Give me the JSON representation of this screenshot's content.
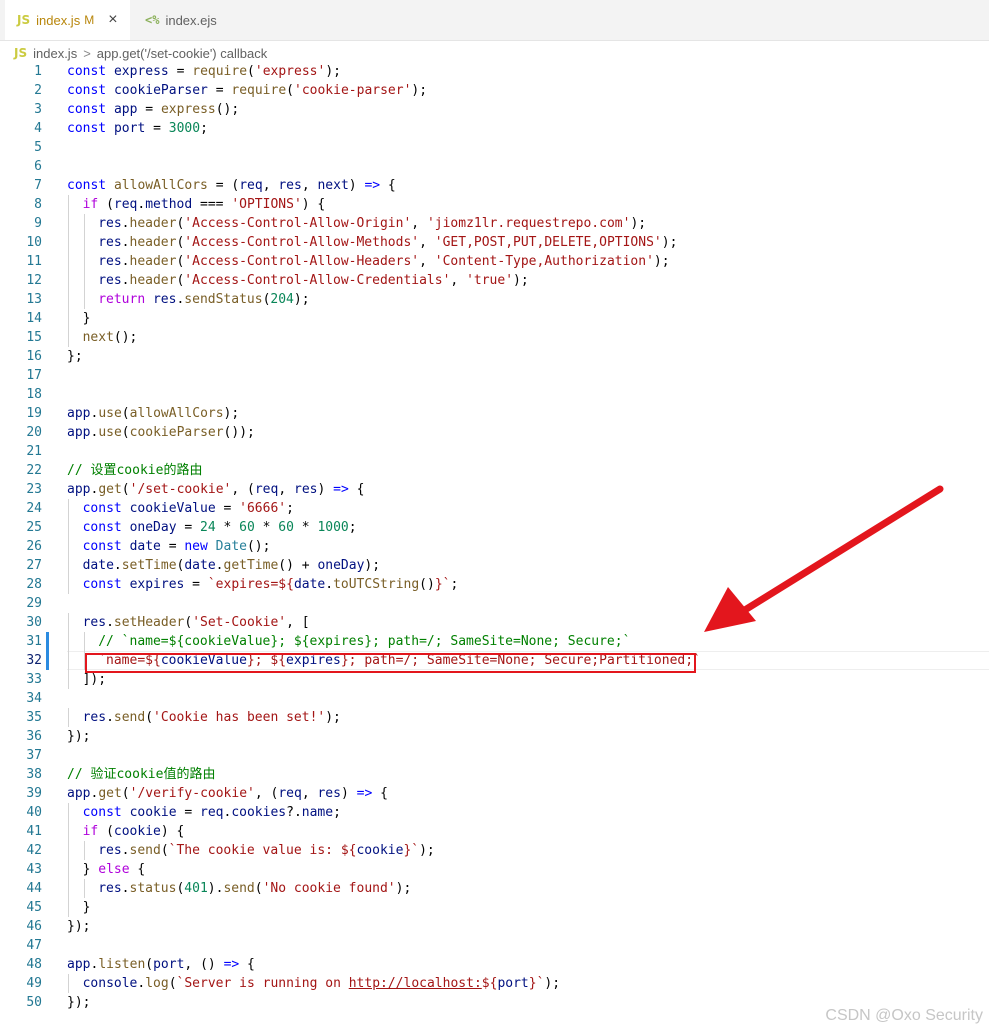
{
  "tabs": [
    {
      "badge": "JS",
      "name": "index.js",
      "modified": "M",
      "close": "×"
    },
    {
      "badge": "<%",
      "name": "index.ejs"
    }
  ],
  "breadcrumb": {
    "badge": "JS",
    "file": "index.js",
    "sep": ">",
    "symbol": "app.get('/set-cookie') callback"
  },
  "lines": [
    {
      "num": "1",
      "indent": 0,
      "tokens": [
        [
          "k",
          "const"
        ],
        [
          "",
          "",
          " "
        ],
        [
          "v",
          "express"
        ],
        [
          "",
          " = "
        ],
        [
          "f",
          "require"
        ],
        [
          "",
          "("
        ],
        [
          "s",
          "'express'"
        ],
        [
          "",
          ");"
        ]
      ]
    },
    {
      "num": "2",
      "indent": 0,
      "tokens": [
        [
          "k",
          "const"
        ],
        [
          "",
          " "
        ],
        [
          "v",
          "cookieParser"
        ],
        [
          "",
          " = "
        ],
        [
          "f",
          "require"
        ],
        [
          "",
          "("
        ],
        [
          "s",
          "'cookie-parser'"
        ],
        [
          "",
          ");"
        ]
      ]
    },
    {
      "num": "3",
      "indent": 0,
      "tokens": [
        [
          "k",
          "const"
        ],
        [
          "",
          " "
        ],
        [
          "v",
          "app"
        ],
        [
          "",
          " = "
        ],
        [
          "f",
          "express"
        ],
        [
          "",
          "();"
        ]
      ]
    },
    {
      "num": "4",
      "indent": 0,
      "tokens": [
        [
          "k",
          "const"
        ],
        [
          "",
          " "
        ],
        [
          "v",
          "port"
        ],
        [
          "",
          " = "
        ],
        [
          "n",
          "3000"
        ],
        [
          "",
          ";"
        ]
      ]
    },
    {
      "num": "5",
      "indent": 0,
      "tokens": []
    },
    {
      "num": "6",
      "indent": 0,
      "tokens": []
    },
    {
      "num": "7",
      "indent": 0,
      "tokens": [
        [
          "k",
          "const"
        ],
        [
          "",
          " "
        ],
        [
          "f",
          "allowAllCors"
        ],
        [
          "",
          " = ("
        ],
        [
          "v",
          "req"
        ],
        [
          "",
          ", "
        ],
        [
          "v",
          "res"
        ],
        [
          "",
          ", "
        ],
        [
          "v",
          "next"
        ],
        [
          "",
          ") "
        ],
        [
          "k",
          "=>"
        ],
        [
          "",
          " {"
        ]
      ]
    },
    {
      "num": "8",
      "indent": 1,
      "tokens": [
        [
          "kc",
          "if"
        ],
        [
          "",
          " ("
        ],
        [
          "v",
          "req"
        ],
        [
          "",
          "."
        ],
        [
          "v",
          "method"
        ],
        [
          "",
          " === "
        ],
        [
          "s",
          "'OPTIONS'"
        ],
        [
          "",
          ") {"
        ]
      ]
    },
    {
      "num": "9",
      "indent": 2,
      "tokens": [
        [
          "v",
          "res"
        ],
        [
          "",
          "."
        ],
        [
          "f",
          "header"
        ],
        [
          "",
          "("
        ],
        [
          "s",
          "'Access-Control-Allow-Origin'"
        ],
        [
          "",
          ", "
        ],
        [
          "s",
          "'jiomz1lr.requestrepo.com'"
        ],
        [
          "",
          ");"
        ]
      ]
    },
    {
      "num": "10",
      "indent": 2,
      "tokens": [
        [
          "v",
          "res"
        ],
        [
          "",
          "."
        ],
        [
          "f",
          "header"
        ],
        [
          "",
          "("
        ],
        [
          "s",
          "'Access-Control-Allow-Methods'"
        ],
        [
          "",
          ", "
        ],
        [
          "s",
          "'GET,POST,PUT,DELETE,OPTIONS'"
        ],
        [
          "",
          ");"
        ]
      ]
    },
    {
      "num": "11",
      "indent": 2,
      "tokens": [
        [
          "v",
          "res"
        ],
        [
          "",
          "."
        ],
        [
          "f",
          "header"
        ],
        [
          "",
          "("
        ],
        [
          "s",
          "'Access-Control-Allow-Headers'"
        ],
        [
          "",
          ", "
        ],
        [
          "s",
          "'Content-Type,Authorization'"
        ],
        [
          "",
          ");"
        ]
      ]
    },
    {
      "num": "12",
      "indent": 2,
      "tokens": [
        [
          "v",
          "res"
        ],
        [
          "",
          "."
        ],
        [
          "f",
          "header"
        ],
        [
          "",
          "("
        ],
        [
          "s",
          "'Access-Control-Allow-Credentials'"
        ],
        [
          "",
          ", "
        ],
        [
          "s",
          "'true'"
        ],
        [
          "",
          ");"
        ]
      ]
    },
    {
      "num": "13",
      "indent": 2,
      "tokens": [
        [
          "kc",
          "return"
        ],
        [
          "",
          " "
        ],
        [
          "v",
          "res"
        ],
        [
          "",
          "."
        ],
        [
          "f",
          "sendStatus"
        ],
        [
          "",
          "("
        ],
        [
          "n",
          "204"
        ],
        [
          "",
          ");"
        ]
      ]
    },
    {
      "num": "14",
      "indent": 1,
      "tokens": [
        [
          "",
          "}"
        ]
      ]
    },
    {
      "num": "15",
      "indent": 1,
      "tokens": [
        [
          "f",
          "next"
        ],
        [
          "",
          "();"
        ]
      ]
    },
    {
      "num": "16",
      "indent": 0,
      "tokens": [
        [
          "",
          "};"
        ]
      ]
    },
    {
      "num": "17",
      "indent": 0,
      "tokens": []
    },
    {
      "num": "18",
      "indent": 0,
      "tokens": []
    },
    {
      "num": "19",
      "indent": 0,
      "tokens": [
        [
          "v",
          "app"
        ],
        [
          "",
          "."
        ],
        [
          "f",
          "use"
        ],
        [
          "",
          "("
        ],
        [
          "f",
          "allowAllCors"
        ],
        [
          "",
          ");"
        ]
      ]
    },
    {
      "num": "20",
      "indent": 0,
      "tokens": [
        [
          "v",
          "app"
        ],
        [
          "",
          "."
        ],
        [
          "f",
          "use"
        ],
        [
          "",
          "("
        ],
        [
          "f",
          "cookieParser"
        ],
        [
          "",
          "());"
        ]
      ]
    },
    {
      "num": "21",
      "indent": 0,
      "tokens": []
    },
    {
      "num": "22",
      "indent": 0,
      "tokens": [
        [
          "c",
          "// 设置cookie的路由"
        ]
      ]
    },
    {
      "num": "23",
      "indent": 0,
      "tokens": [
        [
          "v",
          "app"
        ],
        [
          "",
          "."
        ],
        [
          "f",
          "get"
        ],
        [
          "",
          "("
        ],
        [
          "s",
          "'/set-cookie'"
        ],
        [
          "",
          ", ("
        ],
        [
          "v",
          "req"
        ],
        [
          "",
          ", "
        ],
        [
          "v",
          "res"
        ],
        [
          "",
          ") "
        ],
        [
          "k",
          "=>"
        ],
        [
          "",
          " {"
        ]
      ]
    },
    {
      "num": "24",
      "indent": 1,
      "tokens": [
        [
          "k",
          "const"
        ],
        [
          "",
          " "
        ],
        [
          "v",
          "cookieValue"
        ],
        [
          "",
          " = "
        ],
        [
          "s",
          "'6666'"
        ],
        [
          "",
          ";"
        ]
      ]
    },
    {
      "num": "25",
      "indent": 1,
      "tokens": [
        [
          "k",
          "const"
        ],
        [
          "",
          " "
        ],
        [
          "v",
          "oneDay"
        ],
        [
          "",
          " = "
        ],
        [
          "n",
          "24"
        ],
        [
          "",
          " * "
        ],
        [
          "n",
          "60"
        ],
        [
          "",
          " * "
        ],
        [
          "n",
          "60"
        ],
        [
          "",
          " * "
        ],
        [
          "n",
          "1000"
        ],
        [
          "",
          ";"
        ]
      ]
    },
    {
      "num": "26",
      "indent": 1,
      "tokens": [
        [
          "k",
          "const"
        ],
        [
          "",
          " "
        ],
        [
          "v",
          "date"
        ],
        [
          "",
          " = "
        ],
        [
          "k",
          "new"
        ],
        [
          "",
          " "
        ],
        [
          "t",
          "Date"
        ],
        [
          "",
          "();"
        ]
      ]
    },
    {
      "num": "27",
      "indent": 1,
      "tokens": [
        [
          "v",
          "date"
        ],
        [
          "",
          "."
        ],
        [
          "f",
          "setTime"
        ],
        [
          "",
          "("
        ],
        [
          "v",
          "date"
        ],
        [
          "",
          "."
        ],
        [
          "f",
          "getTime"
        ],
        [
          "",
          "() + "
        ],
        [
          "v",
          "oneDay"
        ],
        [
          "",
          ");"
        ]
      ]
    },
    {
      "num": "28",
      "indent": 1,
      "tokens": [
        [
          "k",
          "const"
        ],
        [
          "",
          " "
        ],
        [
          "v",
          "expires"
        ],
        [
          "",
          " = "
        ],
        [
          "s",
          "`expires=${"
        ],
        [
          "v",
          "date"
        ],
        [
          "",
          "."
        ],
        [
          "f",
          "toUTCString"
        ],
        [
          "",
          "()"
        ],
        [
          "s",
          "}`"
        ],
        [
          "",
          ";"
        ]
      ]
    },
    {
      "num": "29",
      "indent": 0,
      "tokens": []
    },
    {
      "num": "30",
      "indent": 1,
      "tokens": [
        [
          "v",
          "res"
        ],
        [
          "",
          "."
        ],
        [
          "f",
          "setHeader"
        ],
        [
          "",
          "("
        ],
        [
          "s",
          "'Set-Cookie'"
        ],
        [
          "",
          ", ["
        ]
      ]
    },
    {
      "num": "31",
      "indent": 2,
      "tokens": [
        [
          "c",
          "// `name=${cookieValue}; ${expires}; path=/; SameSite=None; Secure;`"
        ]
      ]
    },
    {
      "num": "32",
      "indent": 2,
      "tokens": [
        [
          "s",
          "`name=${"
        ],
        [
          "v",
          "cookieValue"
        ],
        [
          "s",
          "}; ${"
        ],
        [
          "v",
          "expires"
        ],
        [
          "s",
          "}; path=/; SameSite=None; Secure;Partitioned;`"
        ]
      ]
    },
    {
      "num": "33",
      "indent": 1,
      "tokens": [
        [
          "",
          "]);"
        ]
      ]
    },
    {
      "num": "34",
      "indent": 0,
      "tokens": []
    },
    {
      "num": "35",
      "indent": 1,
      "tokens": [
        [
          "v",
          "res"
        ],
        [
          "",
          "."
        ],
        [
          "f",
          "send"
        ],
        [
          "",
          "("
        ],
        [
          "s",
          "'Cookie has been set!'"
        ],
        [
          "",
          ");"
        ]
      ]
    },
    {
      "num": "36",
      "indent": 0,
      "tokens": [
        [
          "",
          "});"
        ]
      ]
    },
    {
      "num": "37",
      "indent": 0,
      "tokens": []
    },
    {
      "num": "38",
      "indent": 0,
      "tokens": [
        [
          "c",
          "// 验证cookie值的路由"
        ]
      ]
    },
    {
      "num": "39",
      "indent": 0,
      "tokens": [
        [
          "v",
          "app"
        ],
        [
          "",
          "."
        ],
        [
          "f",
          "get"
        ],
        [
          "",
          "("
        ],
        [
          "s",
          "'/verify-cookie'"
        ],
        [
          "",
          ", ("
        ],
        [
          "v",
          "req"
        ],
        [
          "",
          ", "
        ],
        [
          "v",
          "res"
        ],
        [
          "",
          ") "
        ],
        [
          "k",
          "=>"
        ],
        [
          "",
          " {"
        ]
      ]
    },
    {
      "num": "40",
      "indent": 1,
      "tokens": [
        [
          "k",
          "const"
        ],
        [
          "",
          " "
        ],
        [
          "v",
          "cookie"
        ],
        [
          "",
          " = "
        ],
        [
          "v",
          "req"
        ],
        [
          "",
          "."
        ],
        [
          "v",
          "cookies"
        ],
        [
          "",
          "?."
        ],
        [
          "v",
          "name"
        ],
        [
          "",
          ";"
        ]
      ]
    },
    {
      "num": "41",
      "indent": 1,
      "tokens": [
        [
          "kc",
          "if"
        ],
        [
          "",
          " ("
        ],
        [
          "v",
          "cookie"
        ],
        [
          "",
          ") {"
        ]
      ]
    },
    {
      "num": "42",
      "indent": 2,
      "tokens": [
        [
          "v",
          "res"
        ],
        [
          "",
          "."
        ],
        [
          "f",
          "send"
        ],
        [
          "",
          "("
        ],
        [
          "s",
          "`The cookie value is: ${"
        ],
        [
          "v",
          "cookie"
        ],
        [
          "s",
          "}`"
        ],
        [
          "",
          ");"
        ]
      ]
    },
    {
      "num": "43",
      "indent": 1,
      "tokens": [
        [
          "",
          "} "
        ],
        [
          "kc",
          "else"
        ],
        [
          "",
          " {"
        ]
      ]
    },
    {
      "num": "44",
      "indent": 2,
      "tokens": [
        [
          "v",
          "res"
        ],
        [
          "",
          "."
        ],
        [
          "f",
          "status"
        ],
        [
          "",
          "("
        ],
        [
          "n",
          "401"
        ],
        [
          "",
          ")."
        ],
        [
          "f",
          "send"
        ],
        [
          "",
          "("
        ],
        [
          "s",
          "'No cookie found'"
        ],
        [
          "",
          ");"
        ]
      ]
    },
    {
      "num": "45",
      "indent": 1,
      "tokens": [
        [
          "",
          "}"
        ]
      ]
    },
    {
      "num": "46",
      "indent": 0,
      "tokens": [
        [
          "",
          "});"
        ]
      ]
    },
    {
      "num": "47",
      "indent": 0,
      "tokens": []
    },
    {
      "num": "48",
      "indent": 0,
      "tokens": [
        [
          "v",
          "app"
        ],
        [
          "",
          "."
        ],
        [
          "f",
          "listen"
        ],
        [
          "",
          "("
        ],
        [
          "v",
          "port"
        ],
        [
          "",
          ", () "
        ],
        [
          "k",
          "=>"
        ],
        [
          "",
          " {"
        ]
      ]
    },
    {
      "num": "49",
      "indent": 1,
      "tokens": [
        [
          "v",
          "console"
        ],
        [
          "",
          "."
        ],
        [
          "f",
          "log"
        ],
        [
          "",
          "("
        ],
        [
          "s",
          "`Server is running on "
        ],
        [
          "su",
          "http://localhost:"
        ],
        [
          "s",
          "${"
        ],
        [
          "v",
          "port"
        ],
        [
          "s",
          "}`"
        ],
        [
          "",
          ");"
        ]
      ]
    },
    {
      "num": "50",
      "indent": 0,
      "tokens": [
        [
          "",
          "});"
        ]
      ]
    }
  ],
  "current_line": "32",
  "annotation": {
    "color": "#e3161d"
  },
  "watermark": "CSDN @Oxo Security"
}
